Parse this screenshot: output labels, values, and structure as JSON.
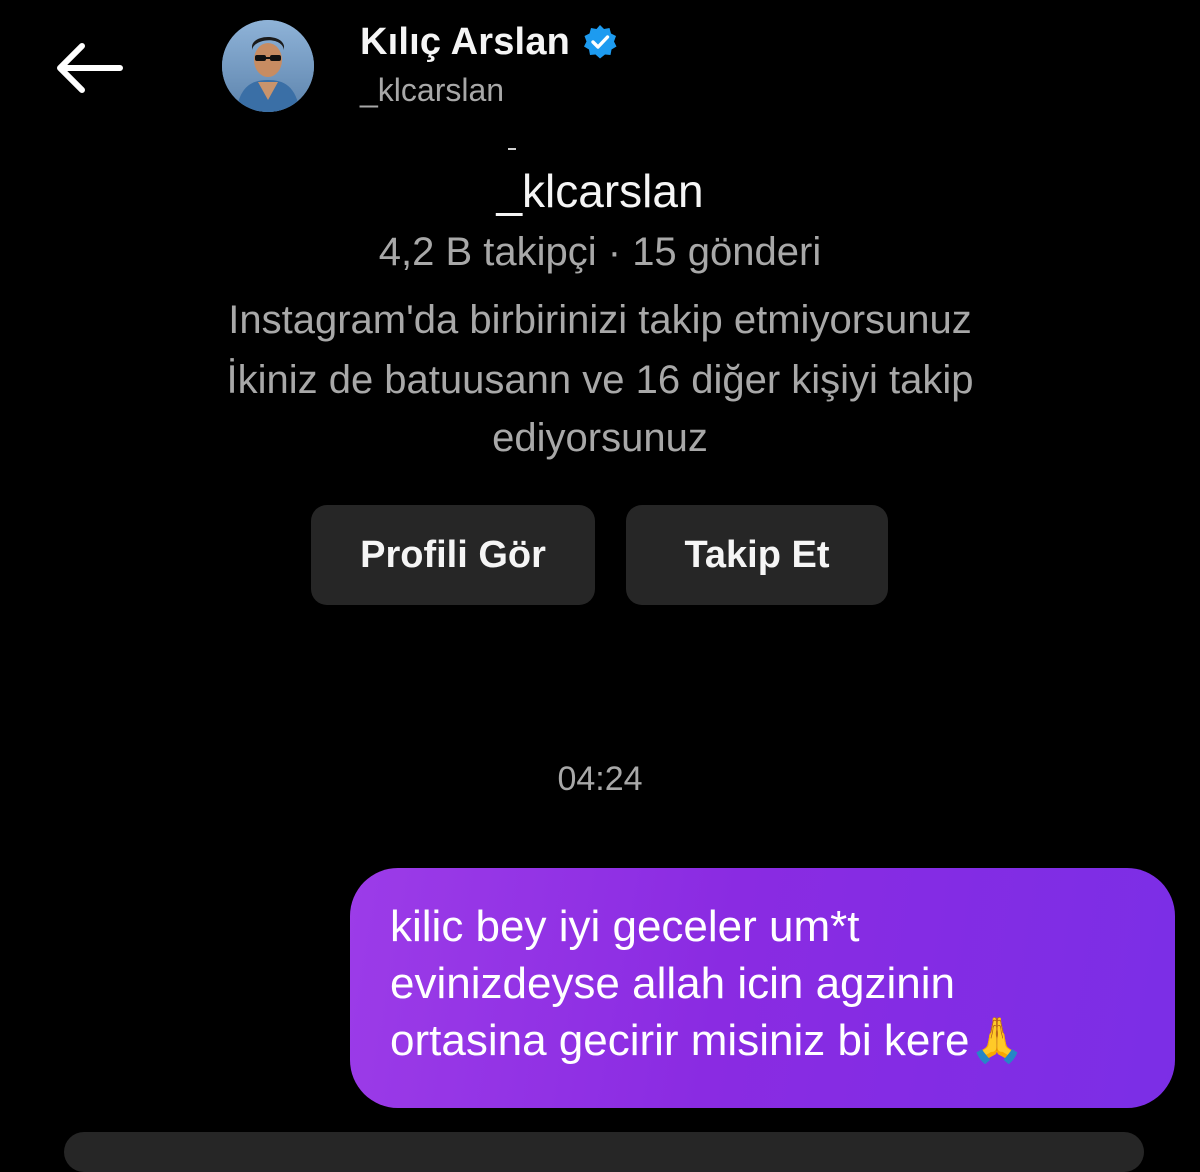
{
  "header": {
    "back_icon": "arrow-left-icon",
    "name": "Kılıç Arslan",
    "verified_icon": "verified-badge-icon",
    "verified_color": "#1d9bf0",
    "username": "_klcarslan"
  },
  "profile_card": {
    "username": "_klcarslan",
    "stats": "4,2 B takipçi · 15 gönderi",
    "follow_status": "Instagram'da birbirinizi takip etmiyorsunuz",
    "mutuals_line1": "İkiniz de batuusann ve 16 diğer kişiyi takip",
    "mutuals_line2": "ediyorsunuz",
    "view_profile_label": "Profili Gör",
    "follow_label": "Takip Et"
  },
  "chat": {
    "timestamp": "04:24",
    "message_line1": "kilic bey iyi geceler um*t",
    "message_line2": "evinizdeyse allah icin agzinin",
    "message_line3": "ortasina gecirir misiniz bi kere🙏",
    "bubble_color": "#8a2be2"
  }
}
